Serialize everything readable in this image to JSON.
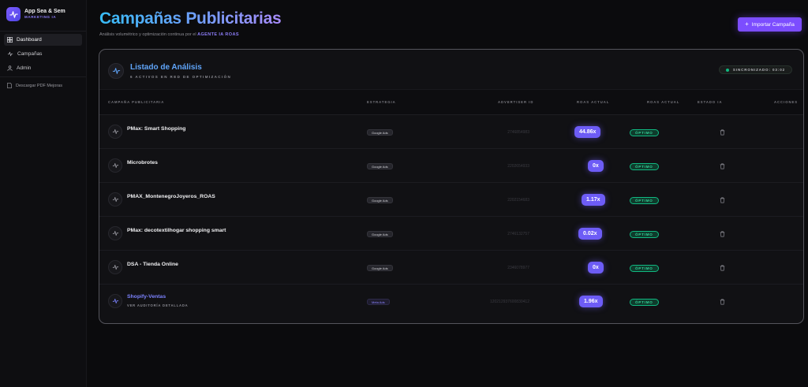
{
  "app": {
    "name": "App Sea & Sem",
    "subtitle": "MARKETING IA"
  },
  "sidebar": {
    "items": [
      {
        "label": "Dashboard",
        "icon": "grid-icon",
        "active": true
      },
      {
        "label": "Campañas",
        "icon": "activity-icon",
        "active": false
      },
      {
        "label": "Admin",
        "icon": "user-icon",
        "active": false
      }
    ],
    "download_label": "Descargar PDF Mejoras"
  },
  "header": {
    "title": "Campañas Publicitarias",
    "subtitle_prefix": "Análisis volumétrico y optimización continua por el",
    "subtitle_highlight": "AGENTE IA ROAS",
    "import_label": "Importar Campaña"
  },
  "panel": {
    "title": "Listado de Análisis",
    "subtitle": "6 ACTIVOS EN RED DE OPTIMIZACIÓN",
    "sync_label": "SINCRONIZADO: 03:02"
  },
  "table": {
    "columns": [
      "CAMPAÑA PUBLICITARIA",
      "ESTRATEGIA",
      "ADVERTISER ID",
      "ROAS ACTUAL",
      "ROAS ACTUAL",
      "ESTADO IA",
      "ACCIONES"
    ],
    "rows": [
      {
        "name": "PMax: Smart Shopping",
        "detail": "",
        "strategy": "Google Ads",
        "id": "2746854983",
        "roas": "44.86x",
        "estado": "ÓPTIMO"
      },
      {
        "name": "Microbrotes",
        "detail": "",
        "strategy": "Google Ads",
        "id": "2202654933",
        "roas": "0x",
        "estado": "ÓPTIMO"
      },
      {
        "name": "PMAX_MontenegroJoyeros_ROAS",
        "detail": "",
        "strategy": "Google Ads",
        "id": "2202154683",
        "roas": "1.17x",
        "estado": "ÓPTIMO"
      },
      {
        "name": "PMax: decotextilhogar shopping smart",
        "detail": "",
        "strategy": "Google Ads",
        "id": "2746132757",
        "roas": "0.02x",
        "estado": "ÓPTIMO"
      },
      {
        "name": "DSA - Tienda Online",
        "detail": "",
        "strategy": "Google Ads",
        "id": "2346078977",
        "roas": "0x",
        "estado": "ÓPTIMO"
      },
      {
        "name": "Shopify-Ventas",
        "detail": "VER AUDITORÍA DETALLADA",
        "strategy": "Meta Ads",
        "id": "120212937600830412",
        "roas": "1.96x",
        "estado": "ÓPTIMO"
      }
    ]
  },
  "colors": {
    "accent": "#7c4dff",
    "roas_pill": "#6d5cf6",
    "status_ok": "#10b981",
    "title_gradient_start": "#38bdf8",
    "title_gradient_end": "#a78bfa"
  }
}
